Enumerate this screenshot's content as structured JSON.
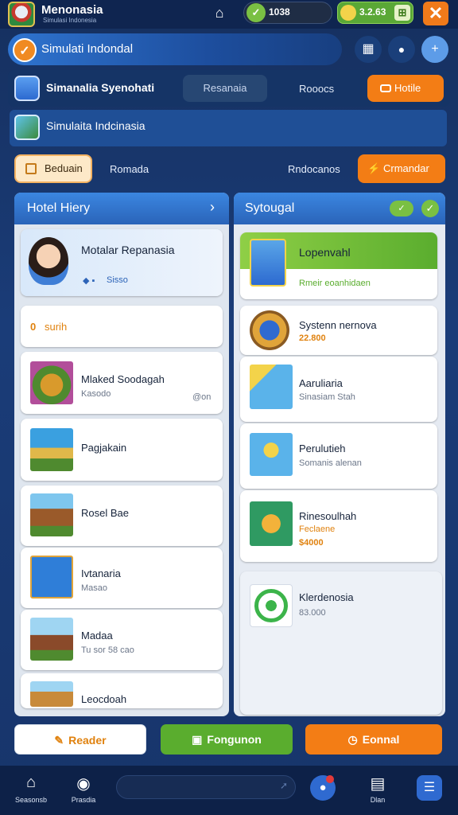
{
  "topbar": {
    "app_name": "Menonasia",
    "app_subtitle": "Simulasi Indonesia",
    "coins": "1038",
    "gems": "3.2.63",
    "close_glyph": "✕",
    "home_glyph": "⌂"
  },
  "header": {
    "title": "Simulati Indondal",
    "buttons": [
      {
        "icon": "grid-icon",
        "glyph": "▦"
      },
      {
        "icon": "location-pin-icon",
        "glyph": "●"
      },
      {
        "icon": "plus-icon",
        "glyph": "+"
      }
    ]
  },
  "nav": {
    "title": "Simanalia Syenohati",
    "tab": "Resanaia",
    "link": "Rooocs",
    "hotel_button": "Hotile"
  },
  "subtitle": "Simulaita Indcinasia",
  "filters": {
    "active": "Beduain",
    "links": [
      "Romada",
      "Rndocanos"
    ],
    "orange": "Crmandar"
  },
  "left_panel": {
    "header": "Hotel Hiery",
    "header_arrow": "›",
    "profile": {
      "name": "Motalar Repanasia",
      "info": "Sisso"
    },
    "section": {
      "number": "0",
      "label": "surih"
    },
    "items": [
      {
        "title": "Mlaked Soodagah",
        "sub": "Kasodo",
        "extra": "@on"
      },
      {
        "title": "Pagjakain",
        "sub": ""
      },
      {
        "title": "Rosel Bae",
        "sub": ""
      },
      {
        "title": "Ivtanaria",
        "sub": "Masao"
      },
      {
        "title": "Madaa",
        "sub": "Tu sor 58 cao"
      },
      {
        "title": "Leocdoah",
        "sub": ""
      }
    ]
  },
  "right_panel": {
    "header": "Sytougal",
    "featured": {
      "title": "Lopenvahl",
      "sub": "Rmeir eoanhidaen"
    },
    "items": [
      {
        "title": "Systenn nernova",
        "sub": "22.800",
        "sub_color": "#e0820f"
      },
      {
        "title": "Aaruliaria",
        "sub": "Sinasiam Stah",
        "sub_color": "#6b7689"
      },
      {
        "title": "Perulutieh",
        "sub": "Somanis alenan",
        "sub_color": "#6b7689"
      },
      {
        "title": "Rinesoulhah",
        "sub": "Feclaene",
        "sub2": "$4000",
        "sub_color": "#e0820f"
      },
      {
        "title": "Klerdenosia",
        "sub": "83.000",
        "sub_color": "#6b7689"
      }
    ]
  },
  "bottom_buttons": [
    {
      "label": "Reader",
      "bg": "#ffffff",
      "fg": "#e0820f"
    },
    {
      "label": "Fongunon",
      "bg": "#5aad2e",
      "fg": "#ffffff"
    },
    {
      "label": "Eonnal",
      "bg": "#f37d15",
      "fg": "#ffffff"
    }
  ],
  "tabbar": {
    "tabs": [
      {
        "label": "Seasonsb",
        "icon": "home-icon"
      },
      {
        "label": "Prasdia",
        "icon": "compass-icon"
      },
      {
        "label": "Dlan",
        "icon": "calendar-icon"
      }
    ]
  }
}
